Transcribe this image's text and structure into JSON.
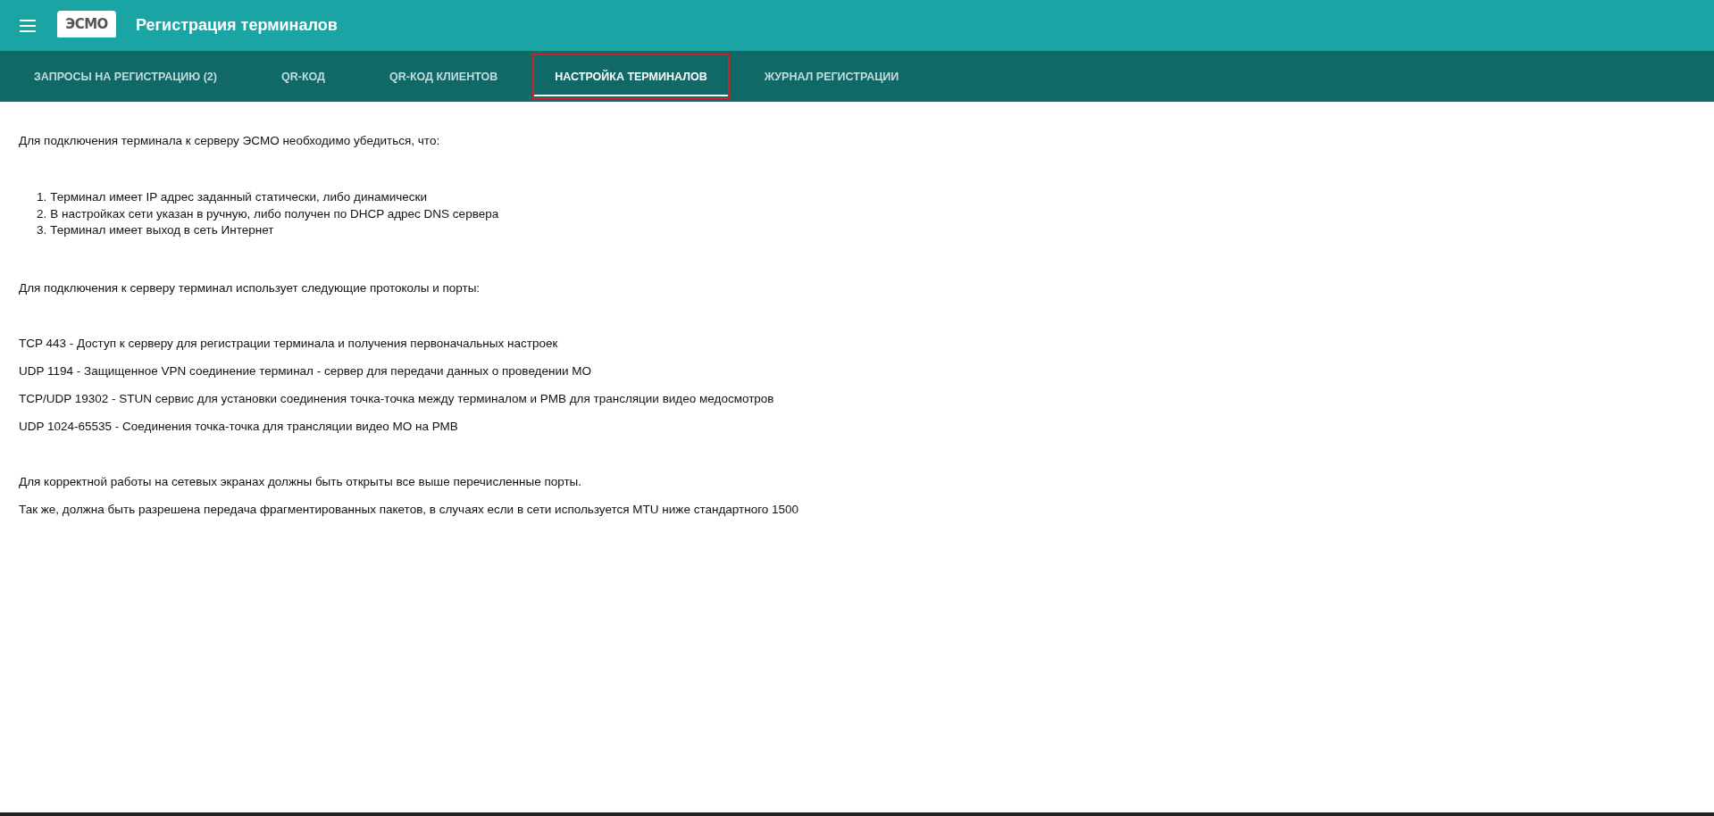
{
  "app_bar": {
    "logo": "ЭСМО",
    "title": "Регистрация терминалов"
  },
  "tabs": [
    {
      "label": "ЗАПРОСЫ НА РЕГИСТРАЦИЮ (2)",
      "selected": false,
      "highlighted": false
    },
    {
      "label": "QR-КОД",
      "selected": false,
      "highlighted": false
    },
    {
      "label": "QR-КОД КЛИЕНТОВ",
      "selected": false,
      "highlighted": false
    },
    {
      "label": "НАСТРОЙКА ТЕРМИНАЛОВ",
      "selected": true,
      "highlighted": true
    },
    {
      "label": "ЖУРНАЛ РЕГИСТРАЦИИ",
      "selected": false,
      "highlighted": false
    }
  ],
  "content": {
    "intro": "Для подключения терминала к серверу ЭСМО необходимо убедиться, что:",
    "requirements": [
      {
        "number": "1.",
        "text": "Терминал имеет IP адрес заданный статически, либо динамически"
      },
      {
        "number": "2.",
        "text": "В настройках сети указан в ручную, либо получен по DHCP адрес DNS сервера"
      },
      {
        "number": "3.",
        "text": "Терминал имеет выход в сеть Интернет"
      }
    ],
    "ports_intro": "Для подключения к серверу терминал использует следующие протоколы и порты:",
    "ports": [
      "TCP 443 - Доступ к серверу для регистрации терминала и получения первоначальных настроек",
      "UDP 1194 - Защищенное VPN соединение терминал - сервер для передачи данных о проведении МО",
      "TCP/UDP 19302 - STUN сервис для установки соединения точка-точка между терминалом и РМВ для трансляции видео медосмотров",
      "UDP 1024-65535 - Соединения точка-точка для трансляции видео МО на РМВ"
    ],
    "notes": [
      "Для корректной работы на сетевых экранах должны быть открыты все выше перечисленные порты.",
      "Так же, должна быть разрешена передача фрагментированных пакетов, в случаях если в сети используется MTU ниже стандартного 1500"
    ]
  }
}
